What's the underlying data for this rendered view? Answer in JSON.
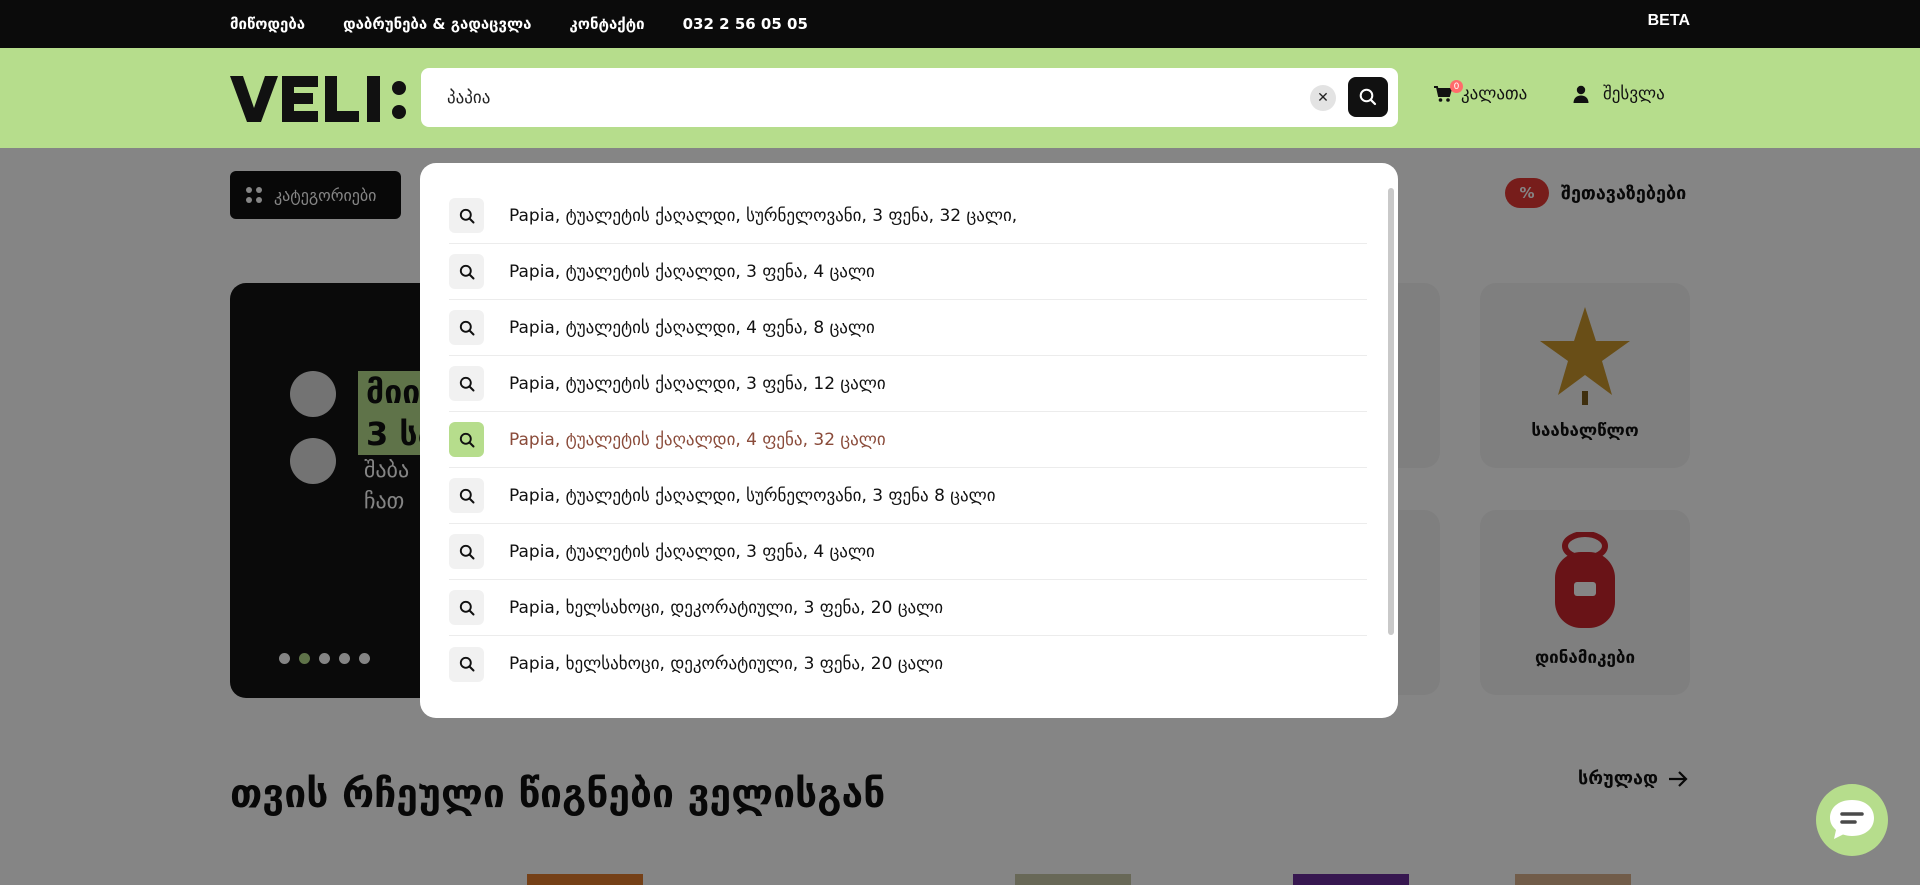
{
  "topbar": {
    "links": [
      "მიწოდება",
      "დაბრუნება & გადაცვლა",
      "კონტაქტი",
      "032 2 56 05 05"
    ],
    "beta": "BETA"
  },
  "header": {
    "logo": "VELI:",
    "search": {
      "value": "პაპია",
      "clear_icon": "close-icon",
      "search_icon": "search-icon"
    },
    "cart": {
      "label": "კალათა",
      "count": "0"
    },
    "login": {
      "label": "შესვლა"
    }
  },
  "nav": {
    "categories_label": "კატეგორიები",
    "offers_badge": "%",
    "offers_label": "შეთავაზებები"
  },
  "hero": {
    "line1": "მიი",
    "line2": "3 სა",
    "sub1": "შაბა",
    "sub2": "ჩათ"
  },
  "tiles": [
    {
      "label": "საახალწლო",
      "icon": "star-icon"
    },
    {
      "label": "დინამიკები",
      "icon": "speaker-icon"
    }
  ],
  "section": {
    "title": "თვის რჩეული წიგნები ველისგან",
    "see_all": "სრულად"
  },
  "suggestions": [
    "Papia, ტუალეტის ქაღალდი, სურნელოვანი, 3 ფენა, 32 ცალი,",
    "Papia, ტუალეტის ქაღალდი, 3 ფენა, 4 ცალი",
    "Papia, ტუალეტის ქაღალდი, 4 ფენა, 8 ცალი",
    "Papia, ტუალეტის ქაღალდი, 3 ფენა, 12 ცალი",
    "Papia, ტუალეტის ქაღალდი, 4 ფენა, 32 ცალი",
    "Papia, ტუალეტის ქაღალდი, სურნელოვანი, 3 ფენა 8 ცალი",
    "Papia, ტუალეტის ქაღალდი, 3 ფენა, 4 ცალი",
    "Papia, ხელსახოცი, დეკორატიული, 3 ფენა, 20 ცალი",
    "Papia, ხელსახოცი, დეკორატიული, 3 ფენა, 20 ცალი"
  ],
  "active_suggestion": 4,
  "colors": {
    "brand_green": "#b6dd8c",
    "dark": "#0b0b0b",
    "active_text": "#8a4b3a"
  }
}
